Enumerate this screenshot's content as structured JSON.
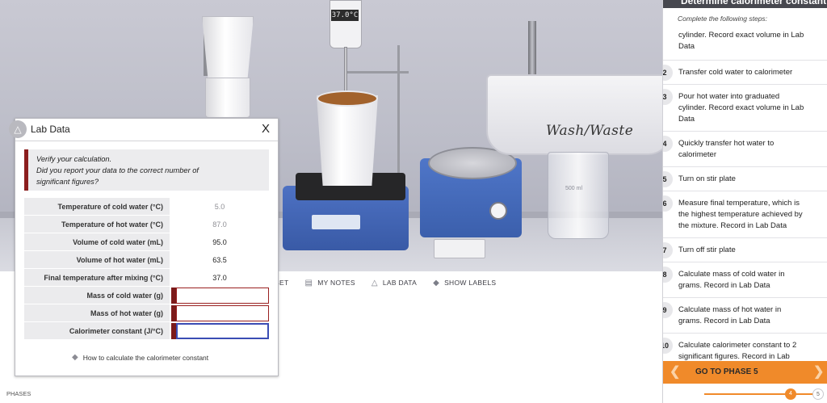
{
  "scene": {
    "thermometer_reading": "37.0°C",
    "wash_label": "Wash/Waste",
    "beaker_label": "500 ml",
    "toolbar": {
      "reset_label": "SET",
      "notes_label": "MY NOTES",
      "labdata_label": "LAB DATA",
      "labels_label": "SHOW LABELS"
    }
  },
  "labdata": {
    "title": "Lab Data",
    "close_label": "X",
    "message_line1": "Verify your calculation.",
    "message_line2": "Did you report your data to the correct number of",
    "message_line3": "significant figures?",
    "rows": [
      {
        "label": "Temperature of cold water (°C)",
        "value": "5.0"
      },
      {
        "label": "Temperature of hot water (°C)",
        "value": "87.0"
      },
      {
        "label": "Volume of cold water (mL)",
        "value": "95.0"
      },
      {
        "label": "Volume of hot water (mL)",
        "value": "63.5"
      },
      {
        "label": "Final temperature after mixing (°C)",
        "value": "37.0"
      },
      {
        "label": "Mass of cold water (g)",
        "value": ""
      },
      {
        "label": "Mass of hot water (g)",
        "value": ""
      },
      {
        "label": "Calorimeter constant (J/°C)",
        "value": ""
      }
    ],
    "help_link": "How to calculate the calorimeter constant"
  },
  "procedure": {
    "title": "Determine calorimeter constant",
    "subtitle": "Complete the following steps:",
    "steps": [
      {
        "num": "",
        "text_1": "cylinder. Record exact volume in Lab",
        "text_2": "Data",
        "text_3": ""
      },
      {
        "num": "2",
        "text_1": "Transfer cold water to calorimeter",
        "text_2": "",
        "text_3": ""
      },
      {
        "num": "3",
        "text_1": "Pour hot water into graduated",
        "text_2": "cylinder. Record exact volume in Lab",
        "text_3": "Data"
      },
      {
        "num": "4",
        "text_1": "Quickly transfer hot water to",
        "text_2": "calorimeter",
        "text_3": ""
      },
      {
        "num": "5",
        "text_1": "Turn on stir plate",
        "text_2": "",
        "text_3": ""
      },
      {
        "num": "6",
        "text_1": "Measure final temperature, which is",
        "text_2": "the highest temperature achieved by",
        "text_3": "the mixture. Record in Lab Data"
      },
      {
        "num": "7",
        "text_1": "Turn off stir plate",
        "text_2": "",
        "text_3": ""
      },
      {
        "num": "8",
        "text_1": "Calculate mass of cold water in",
        "text_2": "grams. Record in Lab Data",
        "text_3": ""
      },
      {
        "num": "9",
        "text_1": "Calculate mass of hot water in",
        "text_2": "grams. Record in Lab Data",
        "text_3": ""
      },
      {
        "num": "10",
        "text_1": "Calculate calorimeter constant to 2",
        "text_2": "significant figures. Record in Lab",
        "text_3": ""
      }
    ],
    "goto_label": "GO TO PHASE 5",
    "phases_label": "PHASES",
    "current_phase": "4",
    "next_phase": "5"
  },
  "colors": {
    "accent": "#f08a2a",
    "error": "#8b1e1e",
    "device_blue": "#4d71c3"
  }
}
